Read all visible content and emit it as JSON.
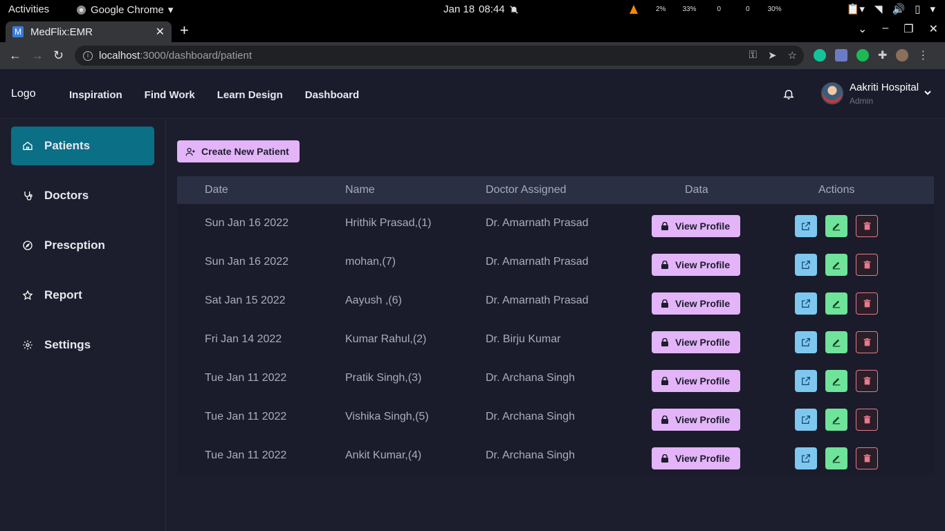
{
  "os_bar": {
    "activities": "Activities",
    "app_name": "Google Chrome",
    "date": "Jan 18",
    "time": "08:44",
    "sys_stats": {
      "cpu": "2%",
      "mem": "33%",
      "net": "0",
      "net2": "0",
      "gpu": "30%"
    }
  },
  "browser": {
    "tab_title": "MedFlix:EMR",
    "tab_favicon": "M",
    "url_host": "localhost",
    "url_path": ":3000/dashboard/patient"
  },
  "header": {
    "logo": "Logo",
    "nav": [
      "Inspiration",
      "Find Work",
      "Learn Design",
      "Dashboard"
    ],
    "user_name": "Aakriti Hospital",
    "user_role": "Admin"
  },
  "sidebar": {
    "items": [
      {
        "label": "Patients",
        "icon": "home-icon",
        "active": true
      },
      {
        "label": "Doctors",
        "icon": "stethoscope-icon",
        "active": false
      },
      {
        "label": "Prescption",
        "icon": "compass-icon",
        "active": false
      },
      {
        "label": "Report",
        "icon": "star-icon",
        "active": false
      },
      {
        "label": "Settings",
        "icon": "gear-icon",
        "active": false
      }
    ]
  },
  "main": {
    "create_button": "Create New Patient",
    "columns": [
      "Date",
      "Name",
      "Doctor Assigned",
      "Data",
      "Actions"
    ],
    "view_profile_label": "View Profile",
    "rows": [
      {
        "date": "Sun Jan 16 2022",
        "name": "Hrithik Prasad,(1)",
        "doctor": "Dr. Amarnath Prasad"
      },
      {
        "date": "Sun Jan 16 2022",
        "name": "mohan,(7)",
        "doctor": "Dr. Amarnath Prasad"
      },
      {
        "date": "Sat Jan 15 2022",
        "name": "Aayush ,(6)",
        "doctor": "Dr. Amarnath Prasad"
      },
      {
        "date": "Fri Jan 14 2022",
        "name": "Kumar Rahul,(2)",
        "doctor": "Dr. Birju Kumar"
      },
      {
        "date": "Tue Jan 11 2022",
        "name": "Pratik Singh,(3)",
        "doctor": "Dr. Archana Singh"
      },
      {
        "date": "Tue Jan 11 2022",
        "name": "Vishika Singh,(5)",
        "doctor": "Dr. Archana Singh"
      },
      {
        "date": "Tue Jan 11 2022",
        "name": "Ankit Kumar,(4)",
        "doctor": "Dr. Archana Singh"
      }
    ]
  },
  "colors": {
    "accent_active": "#0b6f86",
    "button_purple": "#e3b4f7",
    "open_blue": "#7ec8f0",
    "edit_green": "#6fe39a",
    "delete_red": "#e87a8a"
  }
}
